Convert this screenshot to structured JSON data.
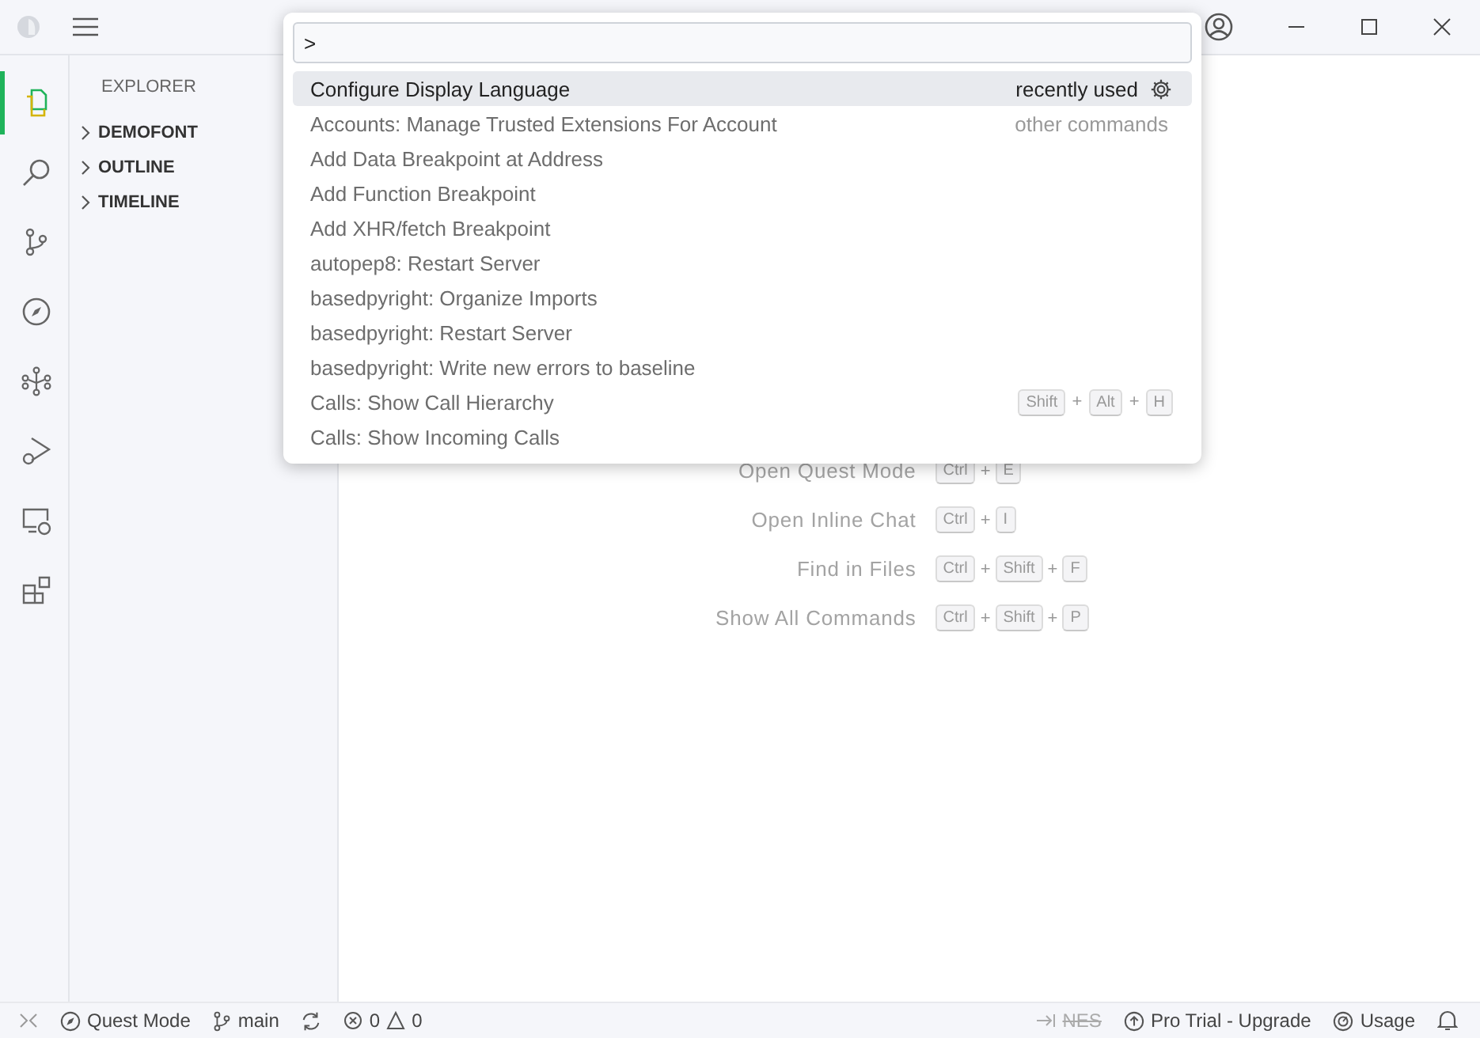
{
  "sidebar": {
    "title": "EXPLORER",
    "sections": [
      {
        "label": "DEMOFONT",
        "expanded": false
      },
      {
        "label": "OUTLINE",
        "expanded": false
      },
      {
        "label": "TIMELINE",
        "expanded": false
      }
    ]
  },
  "activity_bar": [
    {
      "selected": true
    },
    {
      "selected": false
    },
    {
      "selected": false
    },
    {
      "selected": false
    },
    {
      "selected": false
    },
    {
      "selected": false
    },
    {
      "selected": false
    },
    {
      "selected": false
    }
  ],
  "command_palette": {
    "value": ">",
    "items": [
      {
        "label": "Configure Display Language",
        "selected": true,
        "group": "recently used"
      },
      {
        "label": "Accounts: Manage Trusted Extensions For Account",
        "selected": false,
        "group": "other commands"
      },
      {
        "label": "Add Data Breakpoint at Address",
        "selected": false
      },
      {
        "label": "Add Function Breakpoint",
        "selected": false
      },
      {
        "label": "Add XHR/fetch Breakpoint",
        "selected": false
      },
      {
        "label": "autopep8: Restart Server",
        "selected": false
      },
      {
        "label": "basedpyright: Organize Imports",
        "selected": false
      },
      {
        "label": "basedpyright: Restart Server",
        "selected": false
      },
      {
        "label": "basedpyright: Write new errors to baseline",
        "selected": false
      },
      {
        "label": "Calls: Show Call Hierarchy",
        "selected": false,
        "keys": [
          "Shift",
          "Alt",
          "H"
        ]
      },
      {
        "label": "Calls: Show Incoming Calls",
        "selected": false
      }
    ]
  },
  "shortcuts": [
    {
      "label": "Open Quest Mode",
      "keys": [
        "Ctrl",
        "E"
      ]
    },
    {
      "label": "Open Inline Chat",
      "keys": [
        "Ctrl",
        "I"
      ]
    },
    {
      "label": "Find in Files",
      "keys": [
        "Ctrl",
        "Shift",
        "F"
      ]
    },
    {
      "label": "Show All Commands",
      "keys": [
        "Ctrl",
        "Shift",
        "P"
      ]
    }
  ],
  "key_separator": "+",
  "status_bar": {
    "mode": "Quest Mode",
    "branch": "main",
    "errors": "0",
    "warnings": "0",
    "nes": {
      "label": "NES",
      "disabled": true
    },
    "trial": "Pro Trial - Upgrade",
    "usage": "Usage"
  }
}
